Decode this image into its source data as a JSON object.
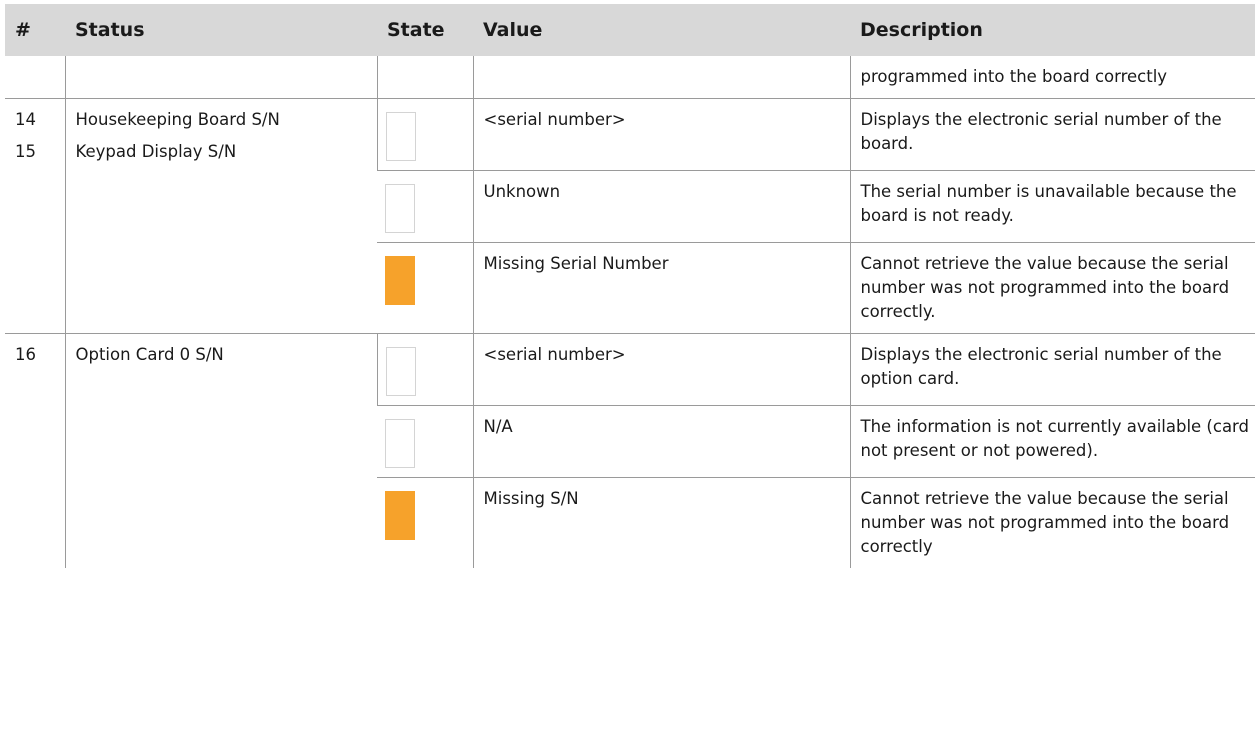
{
  "columns": [
    "#",
    "Status",
    "State",
    "Value",
    "Description"
  ],
  "colors": {
    "warning": "#f6a22b",
    "empty_chip_border": "#d4d4d4",
    "header_bg": "#d8d8d8"
  },
  "continuation": {
    "description": "programmed into the board correctly"
  },
  "groups": [
    {
      "numbers": [
        "14",
        "15"
      ],
      "statuses": [
        "Housekeeping Board S/N",
        "Keypad Display S/N"
      ],
      "rows": [
        {
          "state": "blank",
          "value": "<serial number>",
          "description": "Displays the electronic serial number of the board."
        },
        {
          "state": "blank",
          "value": "Unknown",
          "description": "The serial number is unavailable because the board is not ready."
        },
        {
          "state": "orange",
          "value": "Missing Serial Number",
          "description": "Cannot retrieve the value because the serial number was not programmed into the board correctly."
        }
      ]
    },
    {
      "numbers": [
        "16"
      ],
      "statuses": [
        "Option Card 0 S/N"
      ],
      "rows": [
        {
          "state": "blank",
          "value": "<serial number>",
          "description": "Displays the electronic serial number of the option card."
        },
        {
          "state": "blank",
          "value": "N/A",
          "description": "The information is not currently available (card not present or not powered)."
        },
        {
          "state": "orange",
          "value": "Missing S/N",
          "description": "Cannot retrieve the value because the serial number was not programmed into the board correctly"
        }
      ]
    }
  ]
}
